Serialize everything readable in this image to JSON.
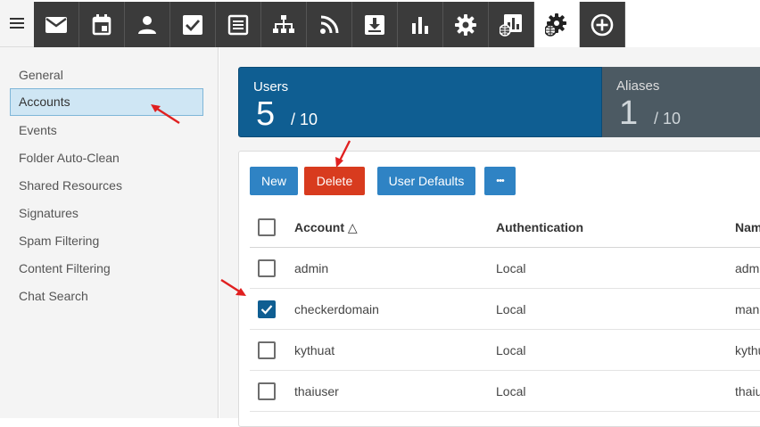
{
  "toolbar": {
    "menu_icon": "hamburger-icon",
    "tools": [
      {
        "name": "mail-icon"
      },
      {
        "name": "calendar-icon"
      },
      {
        "name": "contacts-icon"
      },
      {
        "name": "tasks-icon"
      },
      {
        "name": "notes-icon"
      },
      {
        "name": "sitemap-icon"
      },
      {
        "name": "rss-icon"
      },
      {
        "name": "file-storage-icon"
      },
      {
        "name": "reports-icon"
      },
      {
        "name": "settings-icon"
      },
      {
        "name": "domain-reports-icon"
      },
      {
        "name": "domain-settings-icon",
        "active": true
      },
      {
        "name": "add-circle-icon"
      }
    ]
  },
  "sidebar": {
    "items": [
      {
        "label": "General"
      },
      {
        "label": "Accounts",
        "selected": true
      },
      {
        "label": "Events"
      },
      {
        "label": "Folder Auto-Clean"
      },
      {
        "label": "Shared Resources"
      },
      {
        "label": "Signatures"
      },
      {
        "label": "Spam Filtering"
      },
      {
        "label": "Content Filtering"
      },
      {
        "label": "Chat Search"
      }
    ]
  },
  "stats": {
    "users": {
      "label": "Users",
      "count": "5",
      "total": "/ 10"
    },
    "aliases": {
      "label": "Aliases",
      "count": "1",
      "total": "/ 10"
    }
  },
  "actions": {
    "new_label": "New",
    "delete_label": "Delete",
    "user_defaults_label": "User Defaults",
    "more_label": "•••"
  },
  "table": {
    "columns": [
      "Account △",
      "Authentication",
      "Name"
    ],
    "rows": [
      {
        "account": "admin",
        "auth": "Local",
        "name": "admin",
        "checked": false
      },
      {
        "account": "checkerdomain",
        "auth": "Local",
        "name": "manh",
        "checked": true
      },
      {
        "account": "kythuat",
        "auth": "Local",
        "name": "kythuat",
        "checked": false
      },
      {
        "account": "thaiuser",
        "auth": "Local",
        "name": "thaiuser",
        "checked": false
      }
    ]
  },
  "colors": {
    "toolbar_bg": "#3b3b3b",
    "primary_blue": "#0f5e92",
    "button_blue": "#2f83c4",
    "delete_red": "#d83b1e",
    "annotation_red": "#e02020"
  }
}
